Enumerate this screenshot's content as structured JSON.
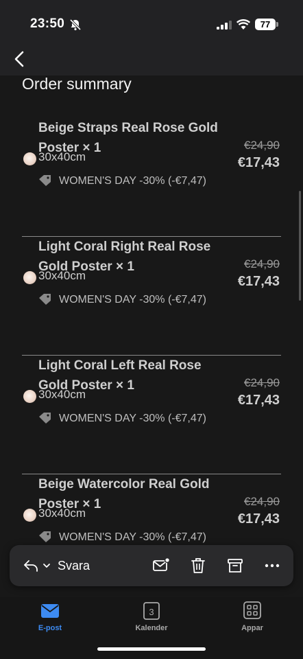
{
  "status_bar": {
    "time": "23:50",
    "battery": "77"
  },
  "heading": "Order summary",
  "items": [
    {
      "title": "Beige Straps Real Rose Gold Poster × 1",
      "variant": "30x40cm",
      "discount": "WOMEN'S DAY -30% (-€7,47)",
      "old_price": "€24,90",
      "new_price": "€17,43"
    },
    {
      "title": "Light Coral Right Real Rose Gold Poster × 1",
      "variant": "30x40cm",
      "discount": "WOMEN'S DAY -30% (-€7,47)",
      "old_price": "€24,90",
      "new_price": "€17,43"
    },
    {
      "title": "Light Coral Left Real Rose Gold Poster × 1",
      "variant": "30x40cm",
      "discount": "WOMEN'S DAY -30% (-€7,47)",
      "old_price": "€24,90",
      "new_price": "€17,43"
    },
    {
      "title": "Beige Watercolor Real Gold Poster × 1",
      "variant": "30x40cm",
      "discount": "WOMEN'S DAY -30% (-€7,47)",
      "old_price": "€24,90",
      "new_price": "€17,43"
    }
  ],
  "toolbar": {
    "reply_label": "Svara"
  },
  "tabs": [
    {
      "label": "E-post",
      "icon": "mail-icon",
      "active": true
    },
    {
      "label": "Kalender",
      "icon": "calendar-icon",
      "date": "3"
    },
    {
      "label": "Appar",
      "icon": "apps-grid-icon"
    }
  ],
  "colors": {
    "accent": "#3d8bf2",
    "background": "#181818",
    "toolbar": "#2a2a2c"
  }
}
